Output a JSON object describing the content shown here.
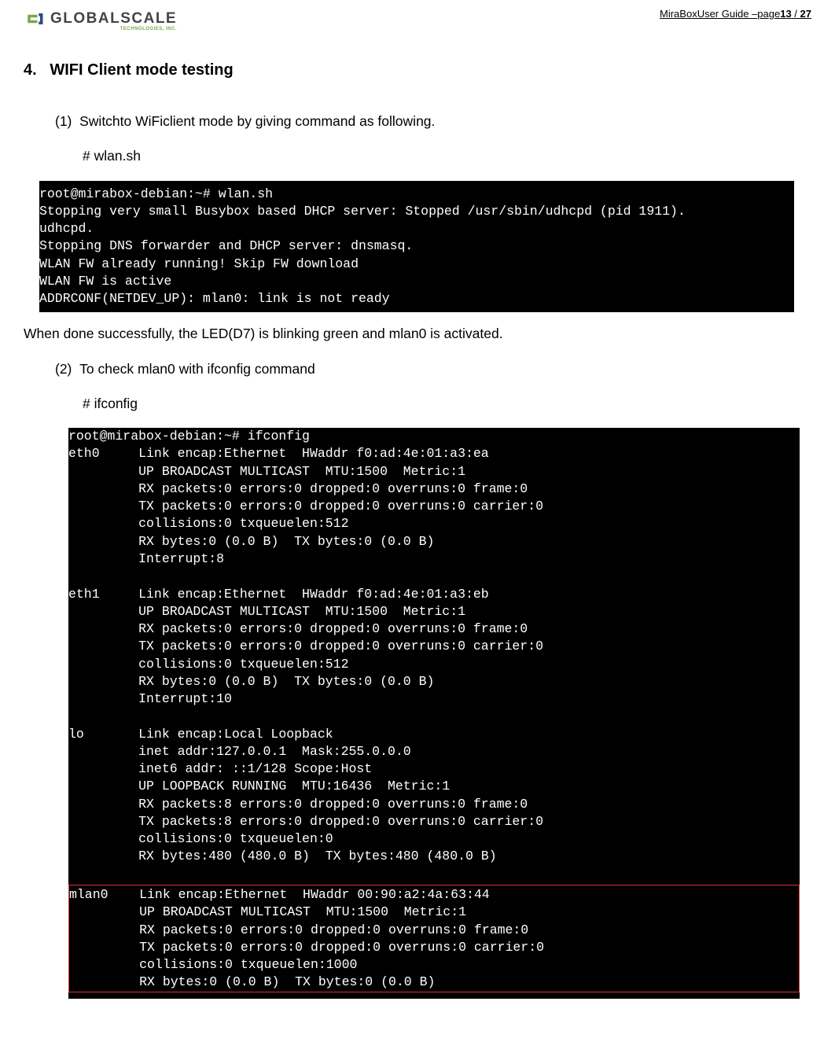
{
  "header": {
    "logo_text": "GLOBALSCALE",
    "logo_sub": "TECHNOLOGIES, INC.",
    "guide_prefix": "MiraBoxUser Guide –page",
    "page_now": "13",
    "page_sep": " / ",
    "page_total": "27"
  },
  "section": {
    "num": "4.",
    "title": "WIFI Client mode testing",
    "step1_num": "(1)",
    "step1_text": "Switchto WiFiclient mode by giving command as following.",
    "step1_cmd": "# wlan.sh",
    "after_term1": "When done successfully, the LED(D7) is blinking green and mlan0 is activated.",
    "step2_num": "(2)",
    "step2_text": "To check mlan0 with ifconfig command",
    "step2_cmd": "# ifconfig"
  },
  "terminal1": {
    "l1": "root@mirabox-debian:~# wlan.sh",
    "l2": "Stopping very small Busybox based DHCP server: Stopped /usr/sbin/udhcpd (pid 1911).",
    "l3": "udhcpd.",
    "l4": "Stopping DNS forwarder and DHCP server: dnsmasq.",
    "l5": "WLAN FW already running! Skip FW download",
    "l6": "WLAN FW is active",
    "l7": "ADDRCONF(NETDEV_UP): mlan0: link is not ready"
  },
  "terminal2": {
    "prompt": "root@mirabox-debian:~# ifconfig",
    "eth0": {
      "name": "eth0",
      "l1": "Link encap:Ethernet  HWaddr f0:ad:4e:01:a3:ea",
      "l2": "UP BROADCAST MULTICAST  MTU:1500  Metric:1",
      "l3": "RX packets:0 errors:0 dropped:0 overruns:0 frame:0",
      "l4": "TX packets:0 errors:0 dropped:0 overruns:0 carrier:0",
      "l5": "collisions:0 txqueuelen:512",
      "l6": "RX bytes:0 (0.0 B)  TX bytes:0 (0.0 B)",
      "l7": "Interrupt:8"
    },
    "eth1": {
      "name": "eth1",
      "l1": "Link encap:Ethernet  HWaddr f0:ad:4e:01:a3:eb",
      "l2": "UP BROADCAST MULTICAST  MTU:1500  Metric:1",
      "l3": "RX packets:0 errors:0 dropped:0 overruns:0 frame:0",
      "l4": "TX packets:0 errors:0 dropped:0 overruns:0 carrier:0",
      "l5": "collisions:0 txqueuelen:512",
      "l6": "RX bytes:0 (0.0 B)  TX bytes:0 (0.0 B)",
      "l7": "Interrupt:10"
    },
    "lo": {
      "name": "lo",
      "l1": "Link encap:Local Loopback",
      "l2": "inet addr:127.0.0.1  Mask:255.0.0.0",
      "l3": "inet6 addr: ::1/128 Scope:Host",
      "l4": "UP LOOPBACK RUNNING  MTU:16436  Metric:1",
      "l5": "RX packets:8 errors:0 dropped:0 overruns:0 frame:0",
      "l6": "TX packets:8 errors:0 dropped:0 overruns:0 carrier:0",
      "l7": "collisions:0 txqueuelen:0",
      "l8": "RX bytes:480 (480.0 B)  TX bytes:480 (480.0 B)"
    },
    "mlan0": {
      "name": "mlan0",
      "l1": "Link encap:Ethernet  HWaddr 00:90:a2:4a:63:44",
      "l2": "UP BROADCAST MULTICAST  MTU:1500  Metric:1",
      "l3": "RX packets:0 errors:0 dropped:0 overruns:0 frame:0",
      "l4": "TX packets:0 errors:0 dropped:0 overruns:0 carrier:0",
      "l5": "collisions:0 txqueuelen:1000",
      "l6": "RX bytes:0 (0.0 B)  TX bytes:0 (0.0 B)"
    }
  }
}
